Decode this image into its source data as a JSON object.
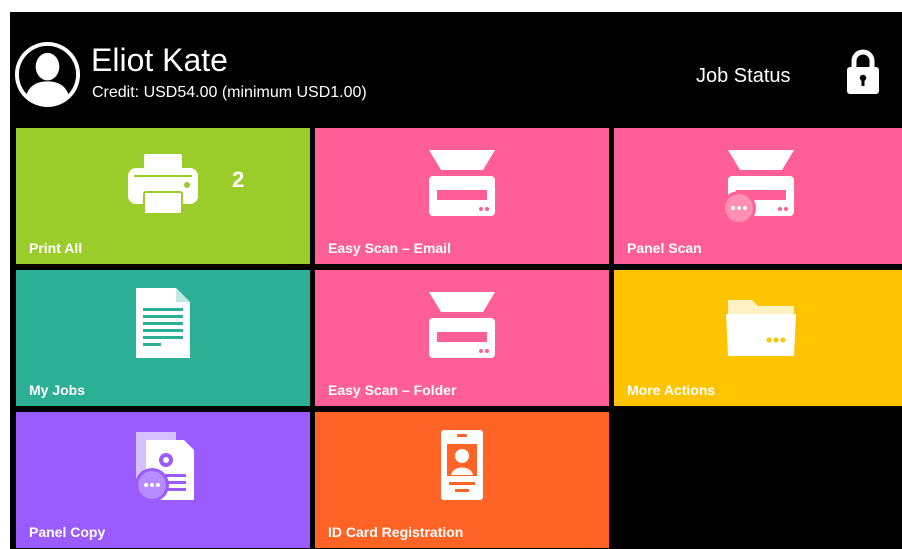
{
  "user": {
    "name": "Eliot Kate",
    "credit": "Credit: USD54.00 (minimum USD1.00)"
  },
  "header": {
    "job_status_label": "Job Status",
    "lock_icon": "lock-icon",
    "avatar_icon": "user-avatar-icon"
  },
  "colors": {
    "background": "#000000",
    "print_all": "#9acd2a",
    "scan": "#ff5f96",
    "my_jobs": "#2bb095",
    "more_actions": "#ffc400",
    "panel_copy": "#9a5cff",
    "id_card": "#ff6325"
  },
  "tiles": [
    {
      "label": "Print All",
      "icon": "printer-icon",
      "badge": "2"
    },
    {
      "label": "Easy Scan – Email",
      "icon": "scanner-icon"
    },
    {
      "label": "Panel Scan",
      "icon": "scanner-more-icon"
    },
    {
      "label": "My Jobs",
      "icon": "document-icon"
    },
    {
      "label": "Easy Scan – Folder",
      "icon": "scanner-icon"
    },
    {
      "label": "More Actions",
      "icon": "folder-more-icon"
    },
    {
      "label": "Panel Copy",
      "icon": "copy-more-icon"
    },
    {
      "label": "ID Card Registration",
      "icon": "id-card-icon"
    }
  ]
}
